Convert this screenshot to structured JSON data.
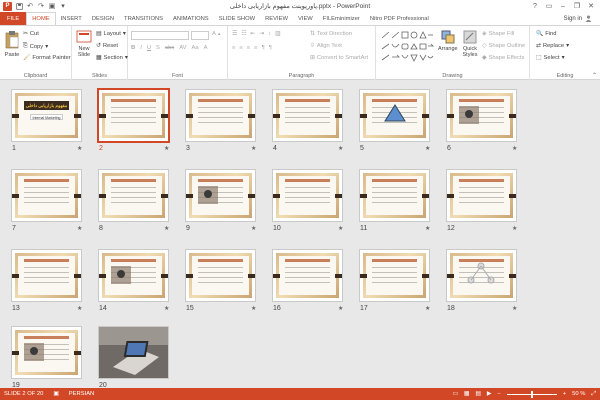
{
  "window": {
    "title": "پاورپوینت مفهوم بازاریابی داخلی.pptx - PowerPoint",
    "app_icon_letter": "P",
    "signin": "Sign in"
  },
  "tabs": [
    "FILE",
    "HOME",
    "INSERT",
    "DESIGN",
    "TRANSITIONS",
    "ANIMATIONS",
    "SLIDE SHOW",
    "REVIEW",
    "VIEW",
    "FILEminimizer",
    "Nitro PDF Professional"
  ],
  "active_tab": "HOME",
  "ribbon": {
    "clipboard": {
      "paste": "Paste",
      "cut": "Cut",
      "copy": "Copy",
      "format_painter": "Format Painter",
      "label": "Clipboard"
    },
    "slides": {
      "new_slide": "New Slide",
      "layout": "Layout",
      "reset": "Reset",
      "section": "Section",
      "label": "Slides"
    },
    "font": {
      "label": "Font"
    },
    "paragraph": {
      "text_direction": "Text Direction",
      "align_text": "Align Text",
      "convert_smartart": "Convert to SmartArt",
      "label": "Paragraph"
    },
    "drawing": {
      "arrange": "Arrange",
      "quick_styles": "Quick Styles",
      "shape_fill": "Shape Fill",
      "shape_outline": "Shape Outline",
      "shape_effects": "Shape Effects",
      "label": "Drawing"
    },
    "editing": {
      "find": "Find",
      "replace": "Replace",
      "select": "Select",
      "label": "Editing"
    }
  },
  "slides": [
    {
      "num": "1",
      "title_color": "#3b2a1e"
    },
    {
      "num": "2"
    },
    {
      "num": "3"
    },
    {
      "num": "4"
    },
    {
      "num": "5"
    },
    {
      "num": "6"
    },
    {
      "num": "7"
    },
    {
      "num": "8"
    },
    {
      "num": "9"
    },
    {
      "num": "10"
    },
    {
      "num": "11"
    },
    {
      "num": "12"
    },
    {
      "num": "13"
    },
    {
      "num": "14"
    },
    {
      "num": "15"
    },
    {
      "num": "16"
    },
    {
      "num": "17"
    },
    {
      "num": "18"
    },
    {
      "num": "19"
    },
    {
      "num": "20"
    }
  ],
  "slide_1_title": "مفهوم بازاریابی داخلی",
  "slide_1_subtitle": "Internal Marketing",
  "selected_slide": "2",
  "star_glyph": "★",
  "status": {
    "slide_info": "SLIDE 2 OF 20",
    "language": "PERSIAN",
    "zoom": "50 %"
  },
  "colors": {
    "accent": "#d24726",
    "background": "#e8e8e8"
  }
}
